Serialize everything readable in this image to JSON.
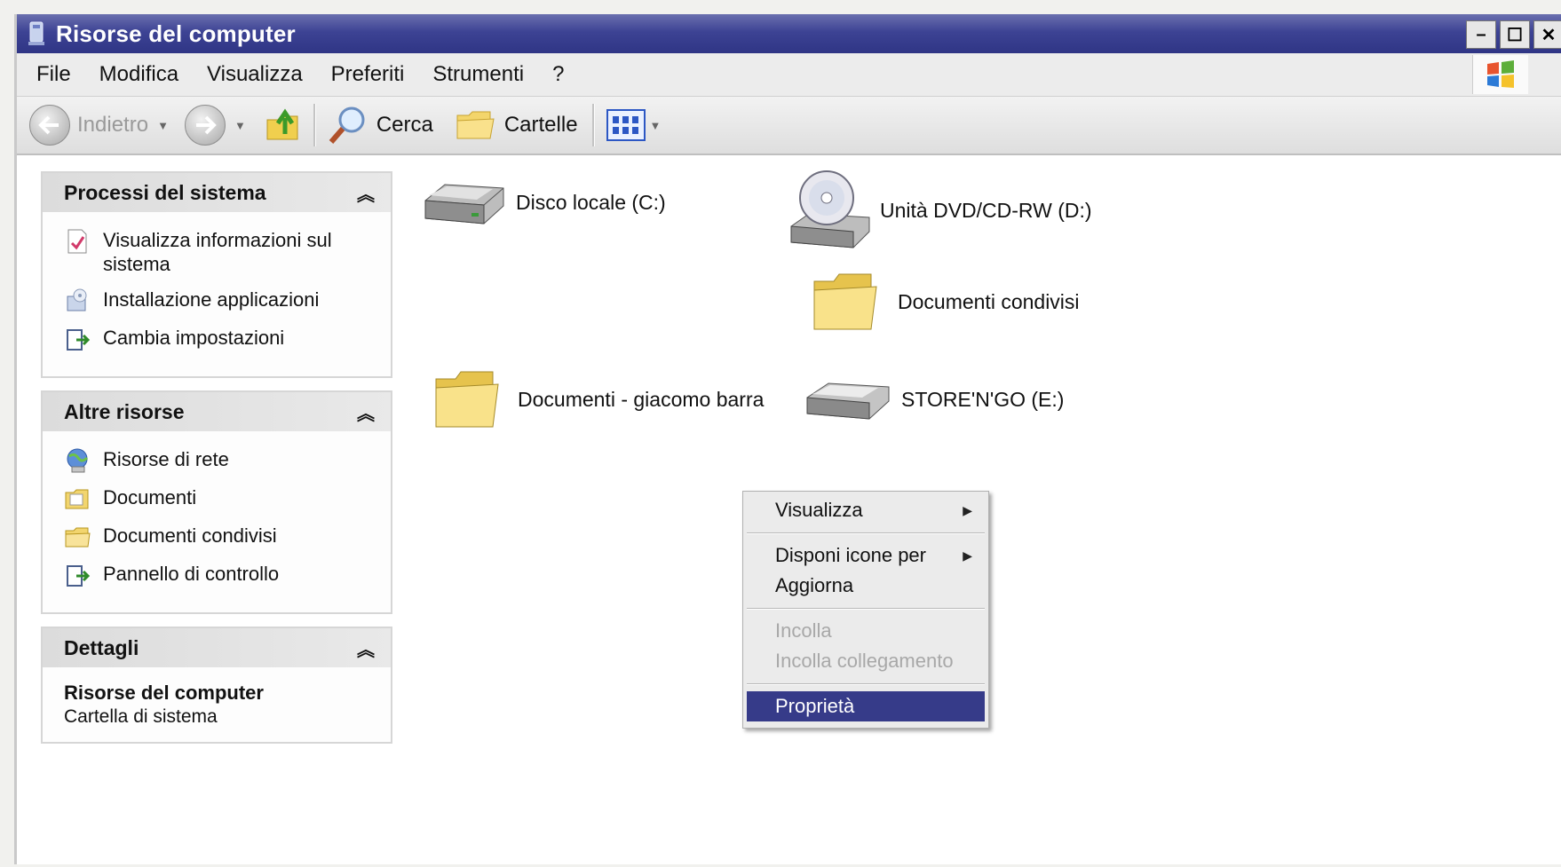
{
  "window": {
    "title": "Risorse del computer"
  },
  "menu": [
    "File",
    "Modifica",
    "Visualizza",
    "Preferiti",
    "Strumenti",
    "?"
  ],
  "toolbar": {
    "back_label": "Indietro",
    "search_label": "Cerca",
    "folders_label": "Cartelle"
  },
  "panels": {
    "system": {
      "title": "Processi del sistema",
      "items": [
        "Visualizza informazioni sul sistema",
        "Installazione applicazioni",
        "Cambia impostazioni"
      ]
    },
    "other": {
      "title": "Altre risorse",
      "items": [
        "Risorse di rete",
        "Documenti",
        "Documenti condivisi",
        "Pannello di controllo"
      ]
    },
    "details": {
      "title": "Dettagli",
      "name": "Risorse del computer",
      "type": "Cartella di sistema"
    }
  },
  "items": {
    "disk_c": "Disco locale (C:)",
    "dvd_d": "Unità DVD/CD-RW (D:)",
    "shared_docs": "Documenti condivisi",
    "user_docs": "Documenti - giacomo barra",
    "store_e": "STORE'N'GO (E:)"
  },
  "context_menu": {
    "view": "Visualizza",
    "arrange": "Disponi icone per",
    "refresh": "Aggiorna",
    "paste": "Incolla",
    "paste_shortcut": "Incolla collegamento",
    "properties": "Proprietà"
  },
  "colors": {
    "titlebar": "#3d4394",
    "selection": "#363b89"
  }
}
